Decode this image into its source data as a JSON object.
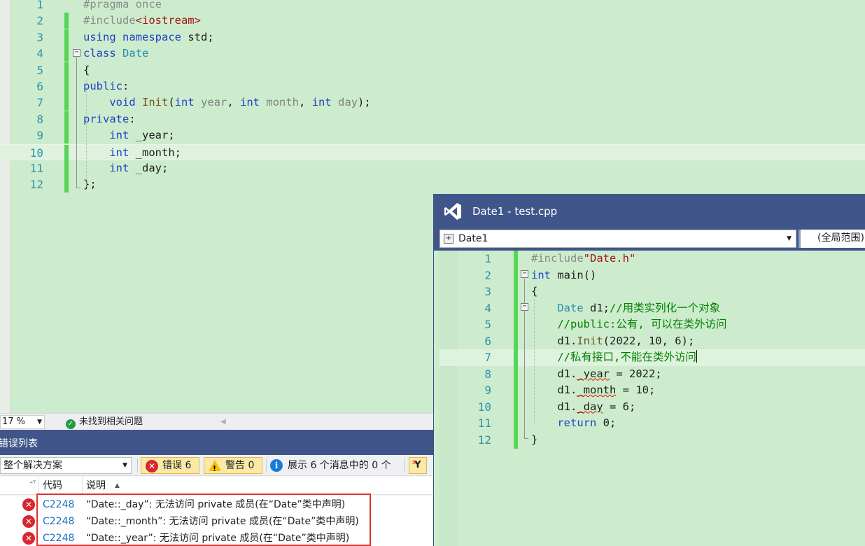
{
  "main_editor": {
    "lines": [
      {
        "num": "1",
        "tokens": [
          {
            "t": "#pragma once",
            "c": "pp"
          }
        ]
      },
      {
        "num": "2",
        "tokens": [
          {
            "t": "#include",
            "c": "pp"
          },
          {
            "t": "<iostream>",
            "c": "str"
          }
        ]
      },
      {
        "num": "3",
        "tokens": [
          {
            "t": "using",
            "c": "kw"
          },
          {
            "t": " ",
            "c": "pl"
          },
          {
            "t": "namespace",
            "c": "kw"
          },
          {
            "t": " std;",
            "c": "pl"
          }
        ]
      },
      {
        "num": "4",
        "tokens": [
          {
            "t": "class",
            "c": "kw"
          },
          {
            "t": " ",
            "c": "pl"
          },
          {
            "t": "Date",
            "c": "ty"
          }
        ]
      },
      {
        "num": "5",
        "tokens": [
          {
            "t": "{",
            "c": "pl"
          }
        ]
      },
      {
        "num": "6",
        "tokens": [
          {
            "t": "public",
            "c": "kw"
          },
          {
            "t": ":",
            "c": "pl"
          }
        ]
      },
      {
        "num": "7",
        "tokens": [
          {
            "t": "    ",
            "c": "pl"
          },
          {
            "t": "void",
            "c": "kw"
          },
          {
            "t": " ",
            "c": "pl"
          },
          {
            "t": "Init",
            "c": "fn"
          },
          {
            "t": "(",
            "c": "pl"
          },
          {
            "t": "int",
            "c": "kw"
          },
          {
            "t": " ",
            "c": "pl"
          },
          {
            "t": "year",
            "c": "pa"
          },
          {
            "t": ", ",
            "c": "pl"
          },
          {
            "t": "int",
            "c": "kw"
          },
          {
            "t": " ",
            "c": "pl"
          },
          {
            "t": "month",
            "c": "pa"
          },
          {
            "t": ", ",
            "c": "pl"
          },
          {
            "t": "int",
            "c": "kw"
          },
          {
            "t": " ",
            "c": "pl"
          },
          {
            "t": "day",
            "c": "pa"
          },
          {
            "t": ");",
            "c": "pl"
          }
        ]
      },
      {
        "num": "8",
        "tokens": [
          {
            "t": "private",
            "c": "kw"
          },
          {
            "t": ":",
            "c": "pl"
          }
        ]
      },
      {
        "num": "9",
        "tokens": [
          {
            "t": "    ",
            "c": "pl"
          },
          {
            "t": "int",
            "c": "kw"
          },
          {
            "t": " _year;",
            "c": "pl"
          }
        ]
      },
      {
        "num": "10",
        "tokens": [
          {
            "t": "    ",
            "c": "pl"
          },
          {
            "t": "int",
            "c": "kw"
          },
          {
            "t": " _month;",
            "c": "pl"
          }
        ]
      },
      {
        "num": "11",
        "tokens": [
          {
            "t": "    ",
            "c": "pl"
          },
          {
            "t": "int",
            "c": "kw"
          },
          {
            "t": " _day;",
            "c": "pl"
          }
        ]
      },
      {
        "num": "12",
        "tokens": [
          {
            "t": "};",
            "c": "pl"
          }
        ]
      }
    ]
  },
  "status_strip": {
    "zoom": "17 %",
    "issues_text": "未找到相关问题"
  },
  "error_list": {
    "title": "错误列表",
    "scope": "整个解决方案",
    "errors_label": "错误 6",
    "warnings_label": "警告 0",
    "messages_label": "展示 6 个消息中的 0 个",
    "col_code": "代码",
    "col_desc": "说明",
    "rows": [
      {
        "code": "C2248",
        "desc": "“Date::_day”: 无法访问 private 成员(在“Date”类中声明)"
      },
      {
        "code": "C2248",
        "desc": "“Date::_month”: 无法访问 private 成员(在“Date”类中声明)"
      },
      {
        "code": "C2248",
        "desc": "“Date::_year”: 无法访问 private 成员(在“Date”类中声明)"
      }
    ]
  },
  "float_window": {
    "title": "Date1 - test.cpp",
    "nav_scope": "Date1",
    "nav_member": "(全局范围)",
    "lines": [
      {
        "num": "1",
        "tokens": [
          {
            "t": "#include",
            "c": "pp"
          },
          {
            "t": "\"Date.h\"",
            "c": "str"
          }
        ]
      },
      {
        "num": "2",
        "tokens": [
          {
            "t": "int",
            "c": "kw"
          },
          {
            "t": " main()",
            "c": "pl"
          }
        ]
      },
      {
        "num": "3",
        "tokens": [
          {
            "t": "{",
            "c": "pl"
          }
        ]
      },
      {
        "num": "4",
        "tokens": [
          {
            "t": "    ",
            "c": "pl"
          },
          {
            "t": "Date",
            "c": "ty"
          },
          {
            "t": " d1;",
            "c": "pl"
          },
          {
            "t": "//用类实列化一个对象",
            "c": "cm"
          }
        ]
      },
      {
        "num": "5",
        "tokens": [
          {
            "t": "    ",
            "c": "pl"
          },
          {
            "t": "//public:公有, 可以在类外访问",
            "c": "cm"
          }
        ]
      },
      {
        "num": "6",
        "tokens": [
          {
            "t": "    d1.",
            "c": "pl"
          },
          {
            "t": "Init",
            "c": "fn"
          },
          {
            "t": "(2022, 10, 6);",
            "c": "pl"
          }
        ]
      },
      {
        "num": "7",
        "tokens": [
          {
            "t": "    ",
            "c": "pl"
          },
          {
            "t": "//私有接口,不能在类外访问",
            "c": "cm"
          }
        ]
      },
      {
        "num": "8",
        "tokens": [
          {
            "t": "    d1.",
            "c": "pl"
          },
          {
            "t": "_year",
            "c": "squig"
          },
          {
            "t": " = 2022;",
            "c": "pl"
          }
        ]
      },
      {
        "num": "9",
        "tokens": [
          {
            "t": "    d1.",
            "c": "pl"
          },
          {
            "t": "_month",
            "c": "squig"
          },
          {
            "t": " = 10;",
            "c": "pl"
          }
        ]
      },
      {
        "num": "10",
        "tokens": [
          {
            "t": "    d1.",
            "c": "pl"
          },
          {
            "t": "_day",
            "c": "squig"
          },
          {
            "t": " = 6;",
            "c": "pl"
          }
        ]
      },
      {
        "num": "11",
        "tokens": [
          {
            "t": "    ",
            "c": "pl"
          },
          {
            "t": "return",
            "c": "kw"
          },
          {
            "t": " 0;",
            "c": "pl"
          }
        ]
      },
      {
        "num": "12",
        "tokens": [
          {
            "t": "}",
            "c": "pl"
          }
        ]
      }
    ]
  }
}
